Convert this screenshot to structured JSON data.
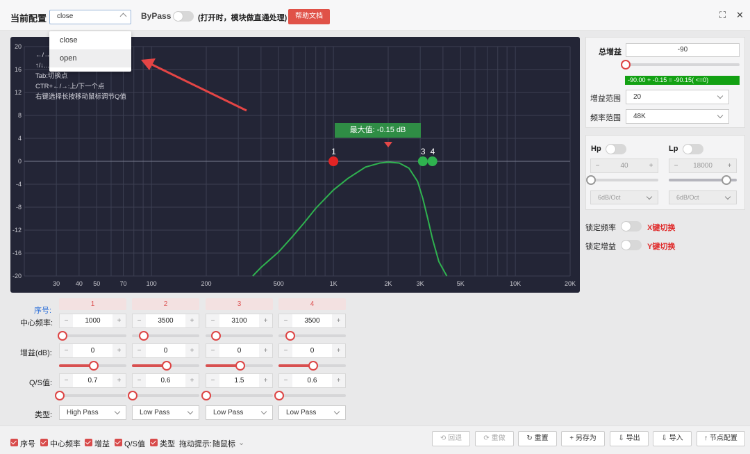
{
  "topbar": {
    "config_label": "当前配置",
    "config_value": "close",
    "bypass_label": "ByPass",
    "bypass_hint": "(打开时，模块做直通处理)",
    "help_button": "帮助文档"
  },
  "dropdown": {
    "options": [
      "close",
      "open"
    ],
    "highlighted": "open"
  },
  "chart": {
    "tooltip": "最大值: -0.15 dB",
    "peak": {
      "freq": 2000,
      "gain": -0.15
    },
    "help_lines": [
      "←/→...",
      "↑/↓...",
      "Tab:切换点",
      "CTR+←/→:上/下一个点",
      "右键选择长按移动鼠标调节Q值"
    ]
  },
  "chart_data": {
    "type": "line",
    "title": "",
    "x_scale": "log",
    "xlim": [
      20,
      20000
    ],
    "ylim": [
      -20,
      20
    ],
    "x_ticks": [
      30,
      40,
      50,
      70,
      100,
      200,
      500,
      1000,
      2000,
      3000,
      5000,
      10000,
      20000
    ],
    "x_tick_labels": [
      "30",
      "40",
      "50",
      "70",
      "100",
      "200",
      "500",
      "1K",
      "2K",
      "3K",
      "5K",
      "10K",
      "20K"
    ],
    "y_ticks": [
      20,
      16,
      12,
      8,
      4,
      0,
      -4,
      -8,
      -12,
      -16,
      -20
    ],
    "grid": true,
    "response_curve": {
      "color": "#2fb24f",
      "x": [
        360,
        400,
        500,
        600,
        700,
        800,
        1000,
        1200,
        1500,
        1800,
        2000,
        2300,
        2600,
        2900,
        3100,
        3300,
        3500,
        3800,
        4200
      ],
      "y": [
        -20,
        -18.5,
        -15.8,
        -13,
        -10.5,
        -8.2,
        -5,
        -3,
        -1,
        -0.3,
        -0.15,
        -0.3,
        -1.2,
        -3.5,
        -6.5,
        -10,
        -13.5,
        -17.5,
        -20
      ]
    },
    "points": [
      {
        "label": "1",
        "freq": 1000,
        "gain": 0,
        "color": "#e22424"
      },
      {
        "label": "3",
        "freq": 3100,
        "gain": 0,
        "color": "#2fb24f"
      },
      {
        "label": "4",
        "freq": 3500,
        "gain": 0,
        "color": "#2fb24f"
      }
    ]
  },
  "right_panel": {
    "total_gain_label": "总增益",
    "total_gain_value": "-90",
    "gain_formula": "-90.00 + -0.15 = -90.15( <=0)",
    "gain_range_label": "增益范围",
    "gain_range_value": "20",
    "freq_range_label": "频率范围",
    "freq_range_value": "48K",
    "hp_label": "Hp",
    "hp_value": "40",
    "hp_slope": "6dB/Oct",
    "lp_label": "Lp",
    "lp_value": "18000",
    "lp_slope": "6dB/Oct",
    "lock_freq_label": "锁定频率",
    "lock_freq_hint": "X键切换",
    "lock_gain_label": "锁定增益",
    "lock_gain_hint": "Y键切换"
  },
  "table": {
    "index_label": "序号:",
    "freq_label": "中心频率:",
    "gain_label": "增益(dB):",
    "q_label": "Q/S值:",
    "type_label": "类型:",
    "columns": [
      {
        "index": "1",
        "freq": "1000",
        "gain": "0",
        "q": "0.7",
        "type": "High Pass",
        "freq_pos": 0.04,
        "gain_pos": 0.5,
        "q_pos": 0.0
      },
      {
        "index": "2",
        "freq": "3500",
        "gain": "0",
        "q": "0.6",
        "type": "Low Pass",
        "freq_pos": 0.16,
        "gain_pos": 0.5,
        "q_pos": 0.0
      },
      {
        "index": "3",
        "freq": "3100",
        "gain": "0",
        "q": "1.5",
        "type": "Low Pass",
        "freq_pos": 0.14,
        "gain_pos": 0.5,
        "q_pos": 0.0
      },
      {
        "index": "4",
        "freq": "3500",
        "gain": "0",
        "q": "0.6",
        "type": "Low Pass",
        "freq_pos": 0.16,
        "gain_pos": 0.5,
        "q_pos": 0.0
      }
    ]
  },
  "bottom": {
    "checkboxes": [
      "序号",
      "中心频率",
      "增益",
      "Q/S值",
      "类型"
    ],
    "drag_hint_label": "拖动提示:",
    "drag_hint_value": "随鼠标",
    "buttons": {
      "undo": "回退",
      "redo": "重做",
      "reset": "重置",
      "save_as": "另存为",
      "export": "导出",
      "import": "导入",
      "node_config": "节点配置"
    }
  },
  "colors": {
    "accent_red": "#e05248",
    "curve_green": "#2fb24f",
    "chart_bg": "#232536"
  }
}
